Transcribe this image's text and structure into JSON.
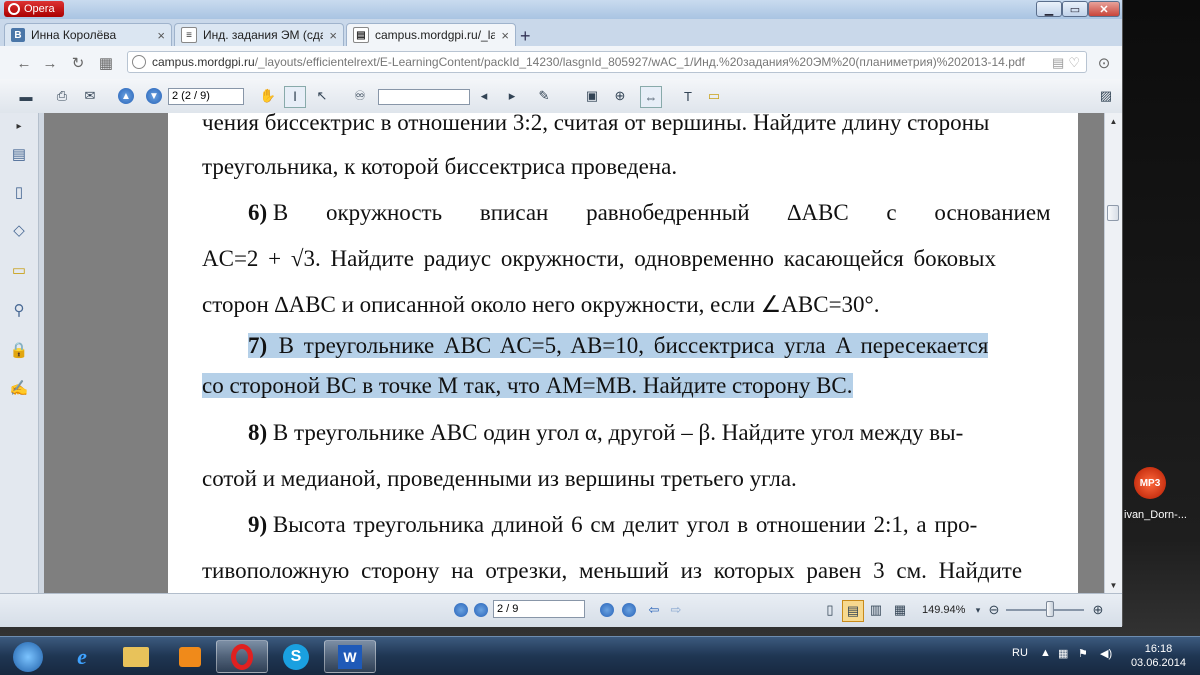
{
  "browser": {
    "menu_label": "Opera",
    "tabs": [
      {
        "label": "Инна Королёва",
        "favicon": "vk-icon"
      },
      {
        "label": "Инд. задания ЭМ (сдаем В",
        "favicon": "document-icon"
      },
      {
        "label": "campus.mordgpi.ru/_layo",
        "favicon": "page-icon"
      }
    ],
    "address": {
      "host": "campus.mordgpi.ru",
      "path": "/_layouts/efficientelrext/E-LearningContent/packId_14230/lasgnId_805927/wAC_1/Инд.%20задания%20ЭМ%20(планиметрия)%202013-14.pdf"
    }
  },
  "pdf_toolbar": {
    "page_field": "2 (2 / 9)"
  },
  "document": {
    "lines": [
      {
        "text": "чения биссектрис в отношении 3:2, считая от вершины. Найдите длину стороны"
      },
      {
        "text": "треугольника, к которой биссектриса проведена."
      },
      {
        "num": "6)",
        "text": "В окружность вписан равнобедренный ∆ABC с основанием"
      },
      {
        "text": "AC=2 + √3. Найдите радиус окружности, одновременно касающейся боковых"
      },
      {
        "text": "сторон ∆ABC и описанной около него окружности, если ∠ABC=30°."
      },
      {
        "num": "7)",
        "text": "В треугольнике ABC AC=5, AB=10, биссектриса угла A пересекается"
      },
      {
        "text": "со стороной BC в точке M так, что AM=MB. Найдите сторону BC."
      },
      {
        "num": "8)",
        "text": "В треугольнике ABC один угол α, другой – β. Найдите угол между вы-"
      },
      {
        "text": "сотой и медианой, проведенными из вершины третьего угла."
      },
      {
        "num": "9)",
        "text": "Высота треугольника длиной 6 см делит угол в отношении 2:1, а про-"
      },
      {
        "text": "тивоположную сторону на отрезки, меньший из которых равен 3 см. Найдите"
      }
    ],
    "highlight_color": "#b5d0e8"
  },
  "status_bar": {
    "page_field": "2 / 9",
    "zoom": "149.94%"
  },
  "desktop": {
    "mp3_badge": "MP3",
    "mp3_label": "ivan_Dorn-..."
  },
  "taskbar": {
    "language": "RU",
    "time": "16:18",
    "date": "03.06.2014"
  }
}
